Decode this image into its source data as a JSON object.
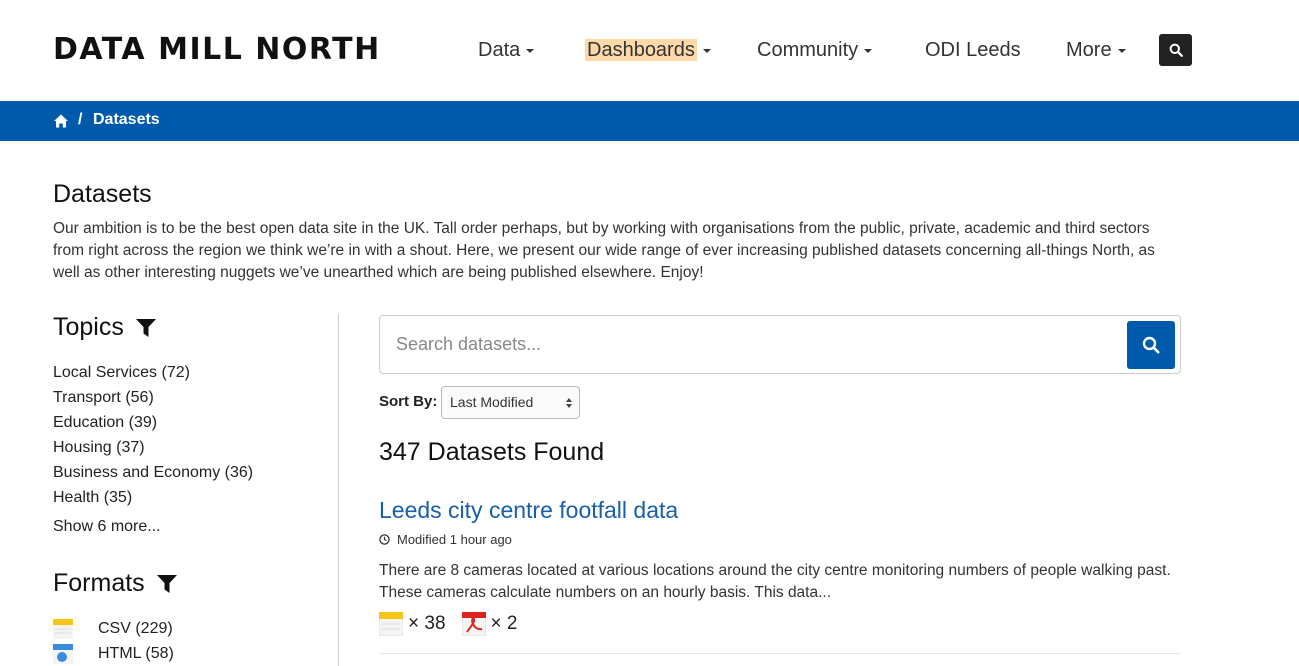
{
  "header": {
    "logo": "DATA MILL NORTH",
    "nav": {
      "data": "Data",
      "dashboards": "Dashboards",
      "community": "Community",
      "odi_leeds": "ODI Leeds",
      "more": "More"
    },
    "search_icon": "search-icon"
  },
  "breadcrumb": {
    "home_icon": "home-icon",
    "separator": "/",
    "current": "Datasets"
  },
  "page": {
    "title": "Datasets",
    "intro": "Our ambition is to be the best open data site in the UK. Tall order perhaps, but by working with organisations from the public, private, academic and third sectors from right across the region we think we’re in with a shout. Here, we present our wide range of ever increasing published datasets concerning all-things North, as well as other interesting nuggets we’ve unearthed which are being published elsewhere. Enjoy!"
  },
  "sidebar": {
    "topics_heading": "Topics",
    "topics": [
      {
        "label": "Local Services (72)"
      },
      {
        "label": "Transport (56)"
      },
      {
        "label": "Education (39)"
      },
      {
        "label": "Housing (37)"
      },
      {
        "label": "Business and Economy (36)"
      },
      {
        "label": "Health (35)"
      }
    ],
    "show_more": "Show 6 more...",
    "formats_heading": "Formats",
    "formats": [
      {
        "label": "CSV (229)",
        "icon": "csv-file-icon"
      },
      {
        "label": "HTML (58)",
        "icon": "html-file-icon"
      }
    ]
  },
  "search": {
    "placeholder": "Search datasets..."
  },
  "sort": {
    "label": "Sort By:",
    "selected": "Last Modified"
  },
  "results": {
    "count_text": "347 Datasets Found",
    "items": [
      {
        "title": "Leeds city centre footfall data",
        "modified": "Modified 1 hour ago",
        "description": "There are 8 cameras located at various locations around the city centre monitoring numbers of people walking past. These cameras calculate numbers on an hourly basis. This data...",
        "formats": [
          {
            "icon": "csv-file-icon",
            "count": "× 38"
          },
          {
            "icon": "pdf-file-icon",
            "count": "× 2"
          }
        ]
      }
    ]
  },
  "colors": {
    "brand_blue": "#005aab",
    "link_blue": "#1a5ea8",
    "highlight": "#fcd9a8"
  }
}
